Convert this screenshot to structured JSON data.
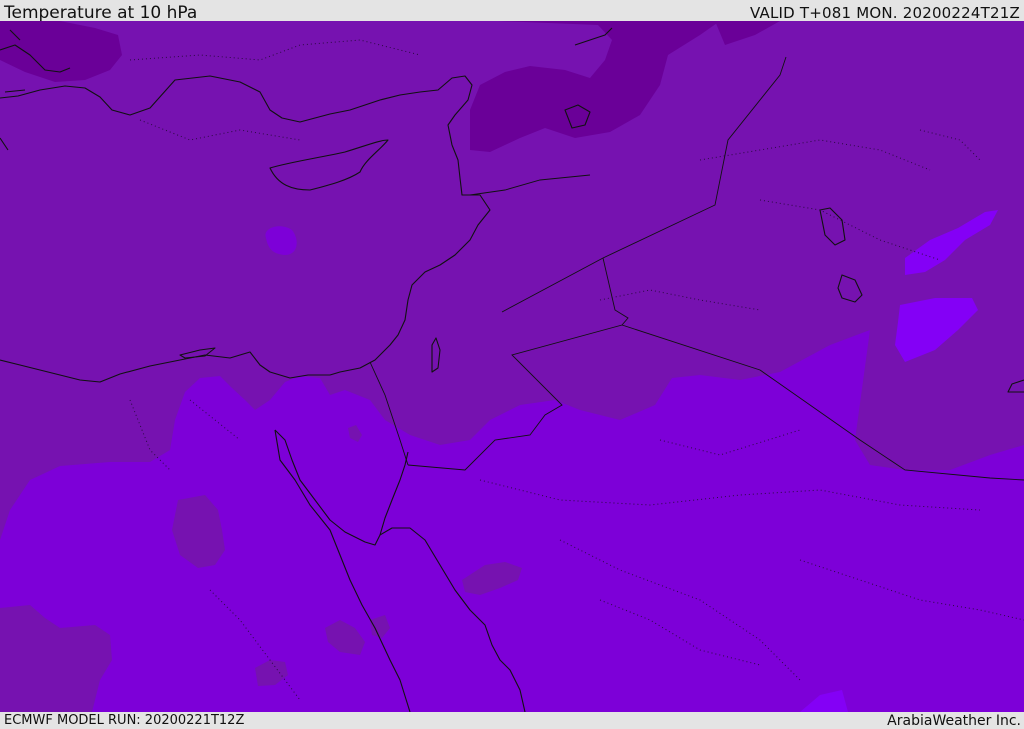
{
  "header": {
    "title": "Temperature at 10 hPa",
    "valid": "VALID T+081 MON. 20200224T21Z"
  },
  "footer": {
    "model_run": "ECMWF MODEL RUN: 20200221T12Z",
    "credit": "ArabiaWeather Inc."
  },
  "colors": {
    "band_darkest": "#6a0098",
    "band_dark": "#7612b0",
    "band_main": "#7d00d8",
    "band_light": "#8400f6",
    "coastline": "#111111"
  }
}
